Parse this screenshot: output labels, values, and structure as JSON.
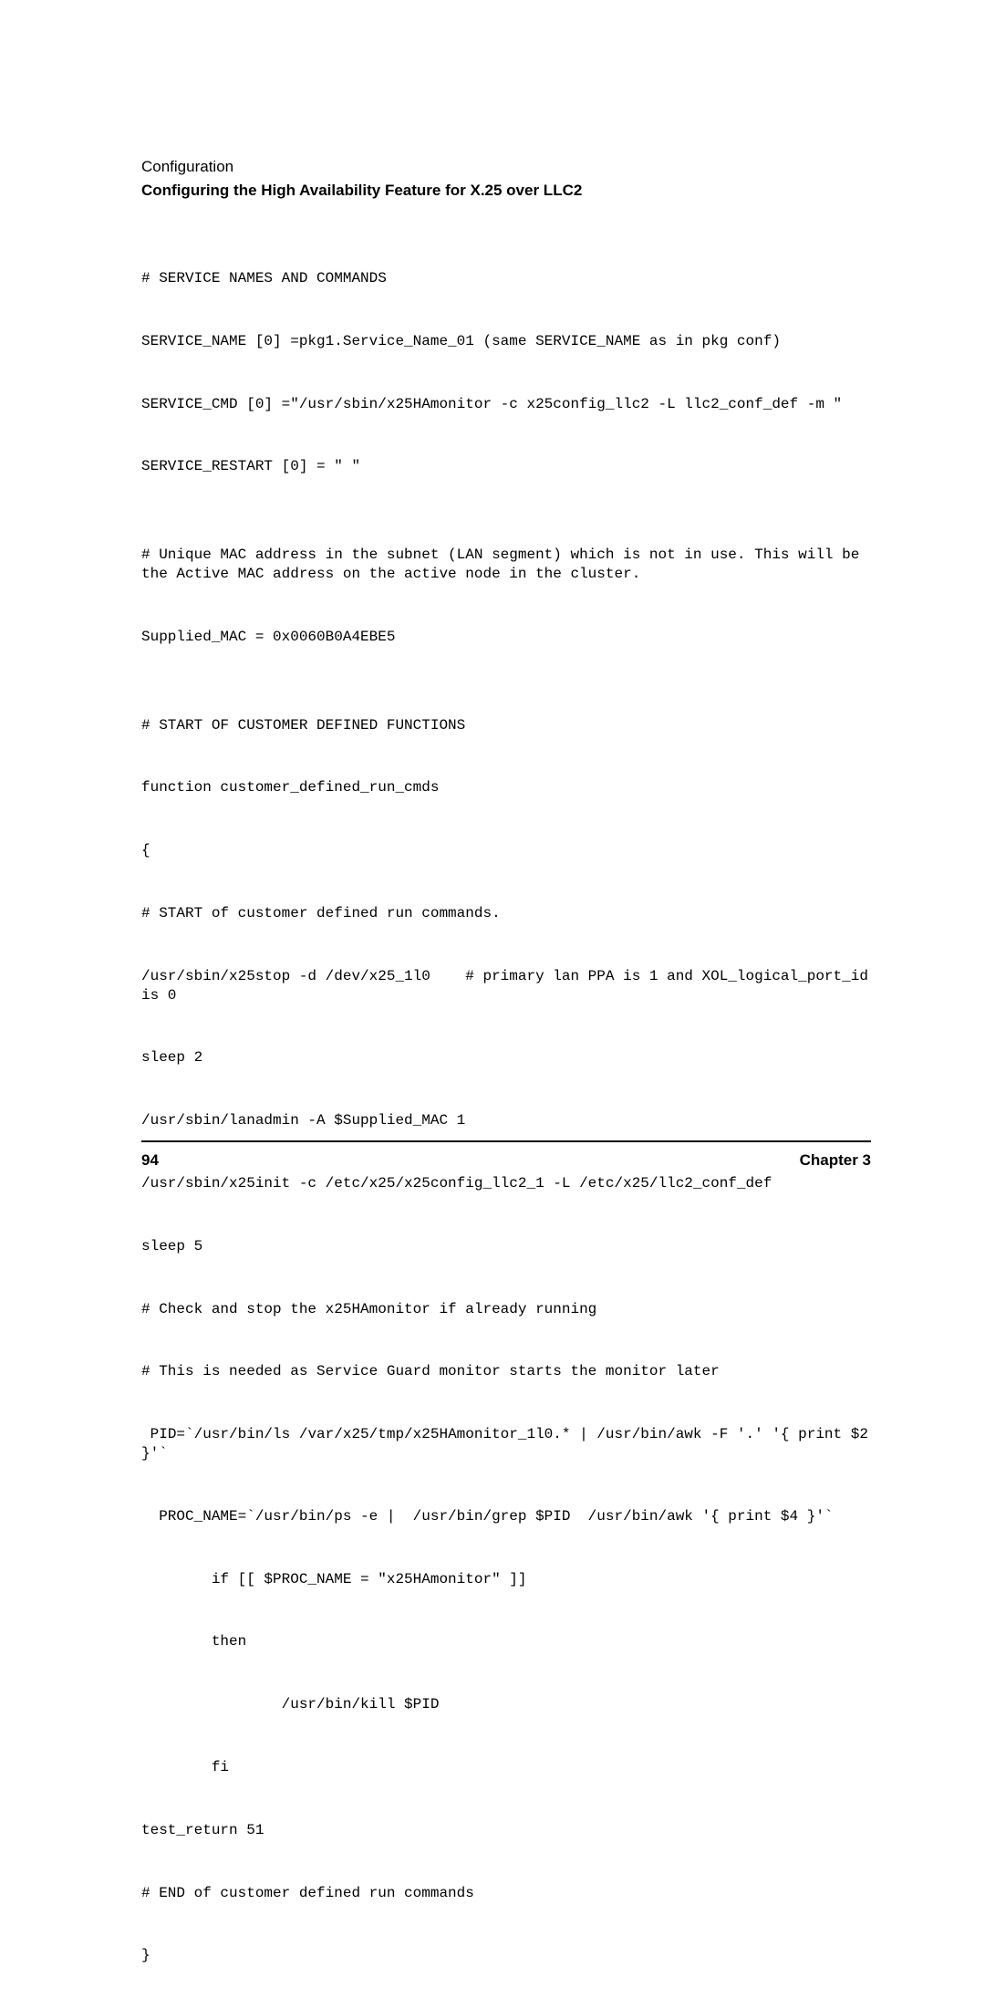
{
  "header": {
    "section": "Configuration",
    "title": "Configuring the High Availability Feature for X.25 over LLC2"
  },
  "code": {
    "l01": "# SERVICE NAMES AND COMMANDS",
    "l02": "SERVICE_NAME [0] =pkg1.Service_Name_01 (same SERVICE_NAME as in pkg conf)",
    "l03": "SERVICE_CMD [0] =\"/usr/sbin/x25HAmonitor -c x25config_llc2 -L llc2_conf_def -m \"",
    "l04": "SERVICE_RESTART [0] = \" \"",
    "l05": "# Unique MAC address in the subnet (LAN segment) which is not in use. This will be the Active MAC address on the active node in the cluster.",
    "l06": "Supplied_MAC = 0x0060B0A4EBE5",
    "l07": "# START OF CUSTOMER DEFINED FUNCTIONS",
    "l08": "function customer_defined_run_cmds",
    "l09": "{",
    "l10": "# START of customer defined run commands.",
    "l11": "/usr/sbin/x25stop -d /dev/x25_1l0    # primary lan PPA is 1 and XOL_logical_port_id is 0",
    "l12": "sleep 2",
    "l13": "/usr/sbin/lanadmin -A $Supplied_MAC 1",
    "l14": "/usr/sbin/x25init -c /etc/x25/x25config_llc2_1 -L /etc/x25/llc2_conf_def",
    "l15": "sleep 5",
    "l16": "# Check and stop the x25HAmonitor if already running",
    "l17": "# This is needed as Service Guard monitor starts the monitor later",
    "l18": " PID=`/usr/bin/ls /var/x25/tmp/x25HAmonitor_1l0.* | /usr/bin/awk -F '.' '{ print $2 }'`",
    "l19": "  PROC_NAME=`/usr/bin/ps -e |  /usr/bin/grep $PID  /usr/bin/awk '{ print $4 }'`",
    "l20": "        if [[ $PROC_NAME = \"x25HAmonitor\" ]]",
    "l21": "        then",
    "l22": "                /usr/bin/kill $PID",
    "l23": "        fi",
    "l24": "test_return 51",
    "l25": "# END of customer defined run commands",
    "l26": "}"
  },
  "footer": {
    "page_number": "94",
    "chapter": "Chapter 3"
  }
}
